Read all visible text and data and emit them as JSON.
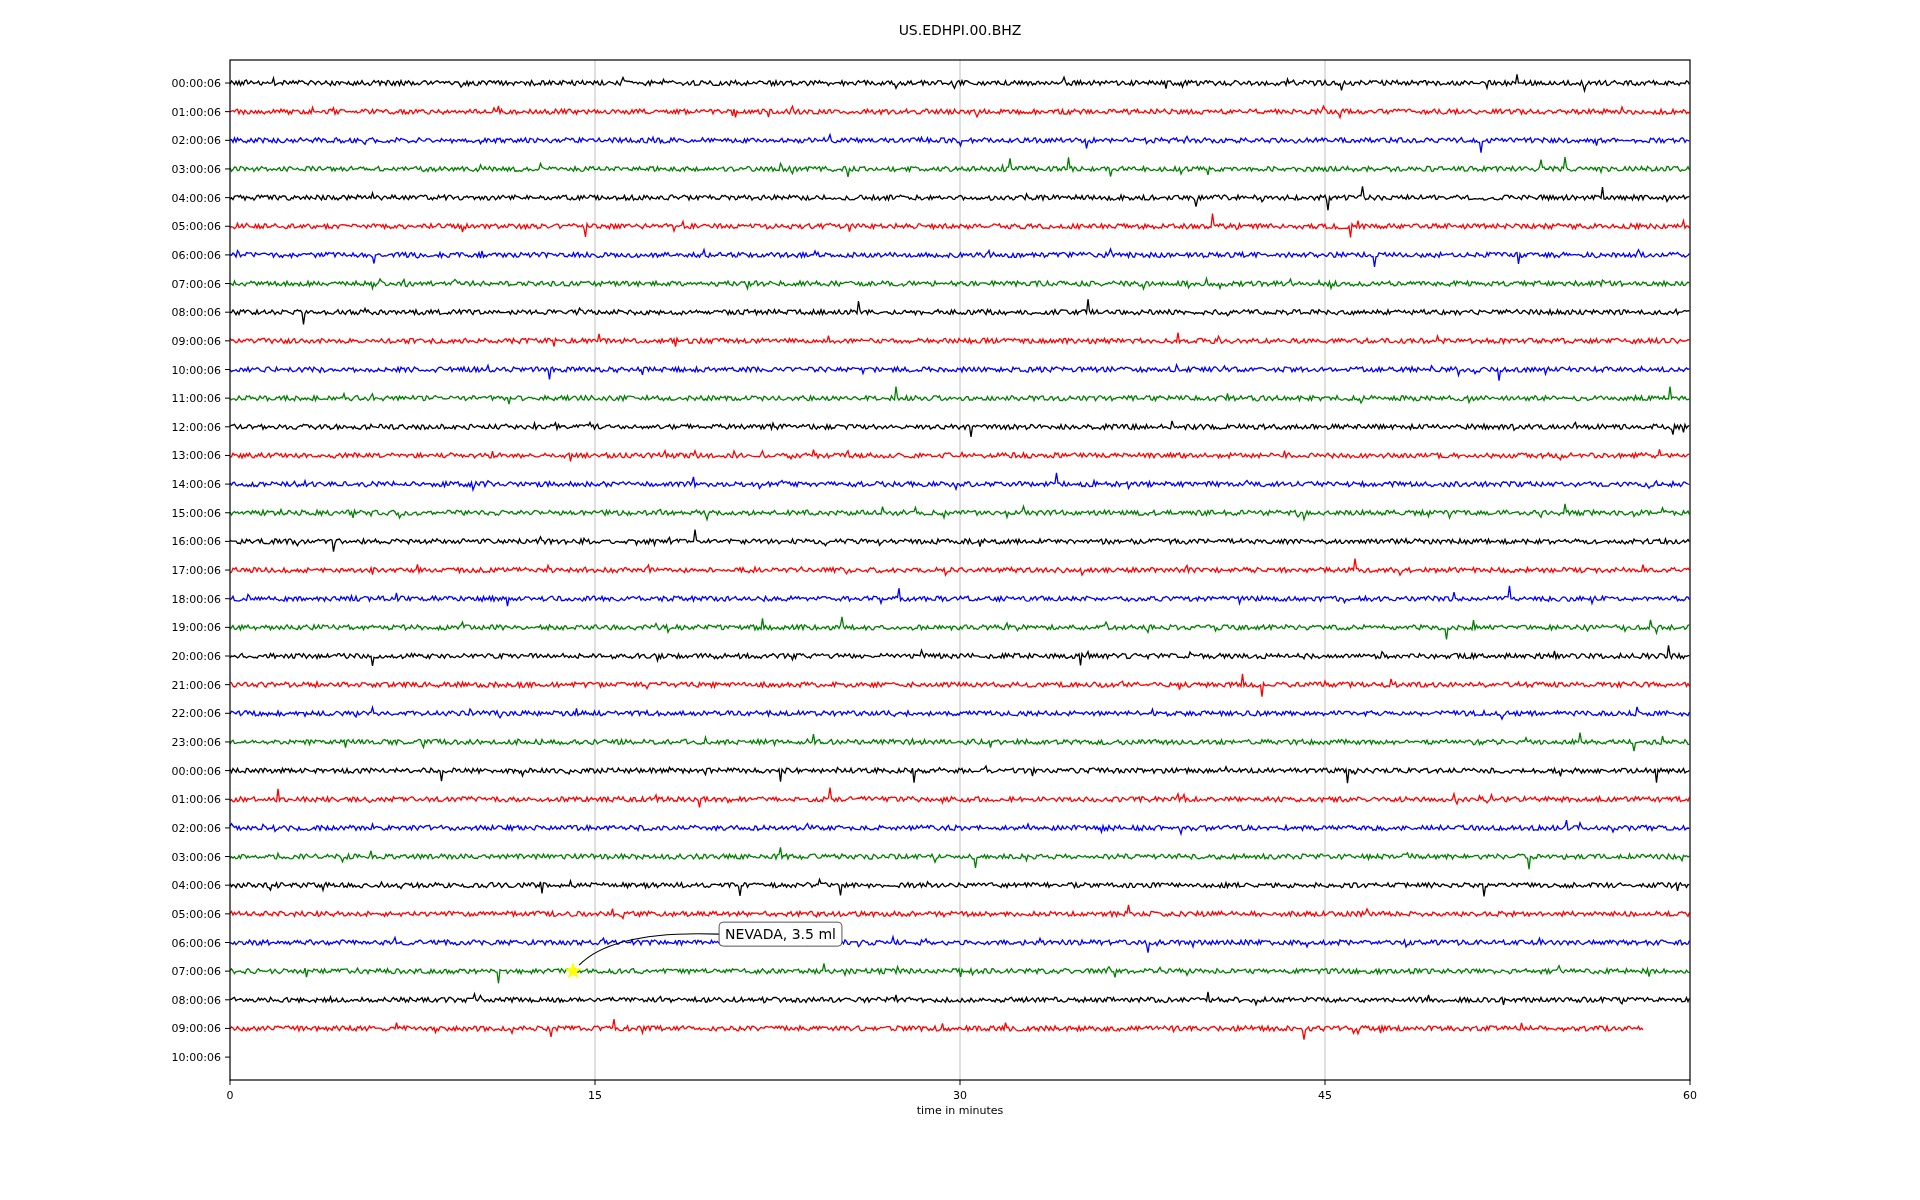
{
  "title": "US.EDHPI.00.BHZ",
  "xlabel": "time in minutes",
  "xticks": [
    "0",
    "15",
    "30",
    "45",
    "60"
  ],
  "row_labels": [
    "00:00:06",
    "01:00:06",
    "02:00:06",
    "03:00:06",
    "04:00:06",
    "05:00:06",
    "06:00:06",
    "07:00:06",
    "08:00:06",
    "09:00:06",
    "10:00:06",
    "11:00:06",
    "12:00:06",
    "13:00:06",
    "14:00:06",
    "15:00:06",
    "16:00:06",
    "17:00:06",
    "18:00:06",
    "19:00:06",
    "20:00:06",
    "21:00:06",
    "22:00:06",
    "23:00:06",
    "00:00:06",
    "01:00:06",
    "02:00:06",
    "03:00:06",
    "04:00:06",
    "05:00:06",
    "06:00:06",
    "07:00:06",
    "08:00:06",
    "09:00:06",
    "10:00:06"
  ],
  "traces": [
    {
      "color": "#000000",
      "level": 1
    },
    {
      "color": "#ff0000",
      "level": 1
    },
    {
      "color": "#0000ff",
      "level": 1
    },
    {
      "color": "#008000",
      "level": 1
    },
    {
      "color": "#000000",
      "level": 1
    },
    {
      "color": "#ff0000",
      "level": 1
    },
    {
      "color": "#0000ff",
      "level": 1
    },
    {
      "color": "#008000",
      "level": 1
    },
    {
      "color": "#000000",
      "level": 1
    },
    {
      "color": "#ff0000",
      "level": 1
    },
    {
      "color": "#0000ff",
      "level": 1
    },
    {
      "color": "#008000",
      "level": 1
    },
    {
      "color": "#000000",
      "level": 1
    },
    {
      "color": "#ff0000",
      "level": 1
    },
    {
      "color": "#0000ff",
      "level": 1
    },
    {
      "color": "#008000",
      "level": 1
    },
    {
      "color": "#000000",
      "level": 1
    },
    {
      "color": "#ff0000",
      "level": 1
    },
    {
      "color": "#0000ff",
      "level": 1
    },
    {
      "color": "#008000",
      "level": 1
    },
    {
      "color": "#000000",
      "level": 1
    },
    {
      "color": "#ff0000",
      "level": 1
    },
    {
      "color": "#0000ff",
      "level": 1
    },
    {
      "color": "#008000",
      "level": 1
    },
    {
      "color": "#000000",
      "level": 1
    },
    {
      "color": "#ff0000",
      "level": 1
    },
    {
      "color": "#0000ff",
      "level": 1
    },
    {
      "color": "#008000",
      "level": 1
    },
    {
      "color": "#000000",
      "level": 1
    },
    {
      "color": "#ff0000",
      "level": 1
    },
    {
      "color": "#0000ff",
      "level": 1
    },
    {
      "color": "#008000",
      "level": 1,
      "event": {
        "text": "NEVADA, 3.5 ml"
      }
    },
    {
      "color": "#000000",
      "level": 1
    },
    {
      "color": "#ff0000",
      "level": 0.968
    }
  ]
}
